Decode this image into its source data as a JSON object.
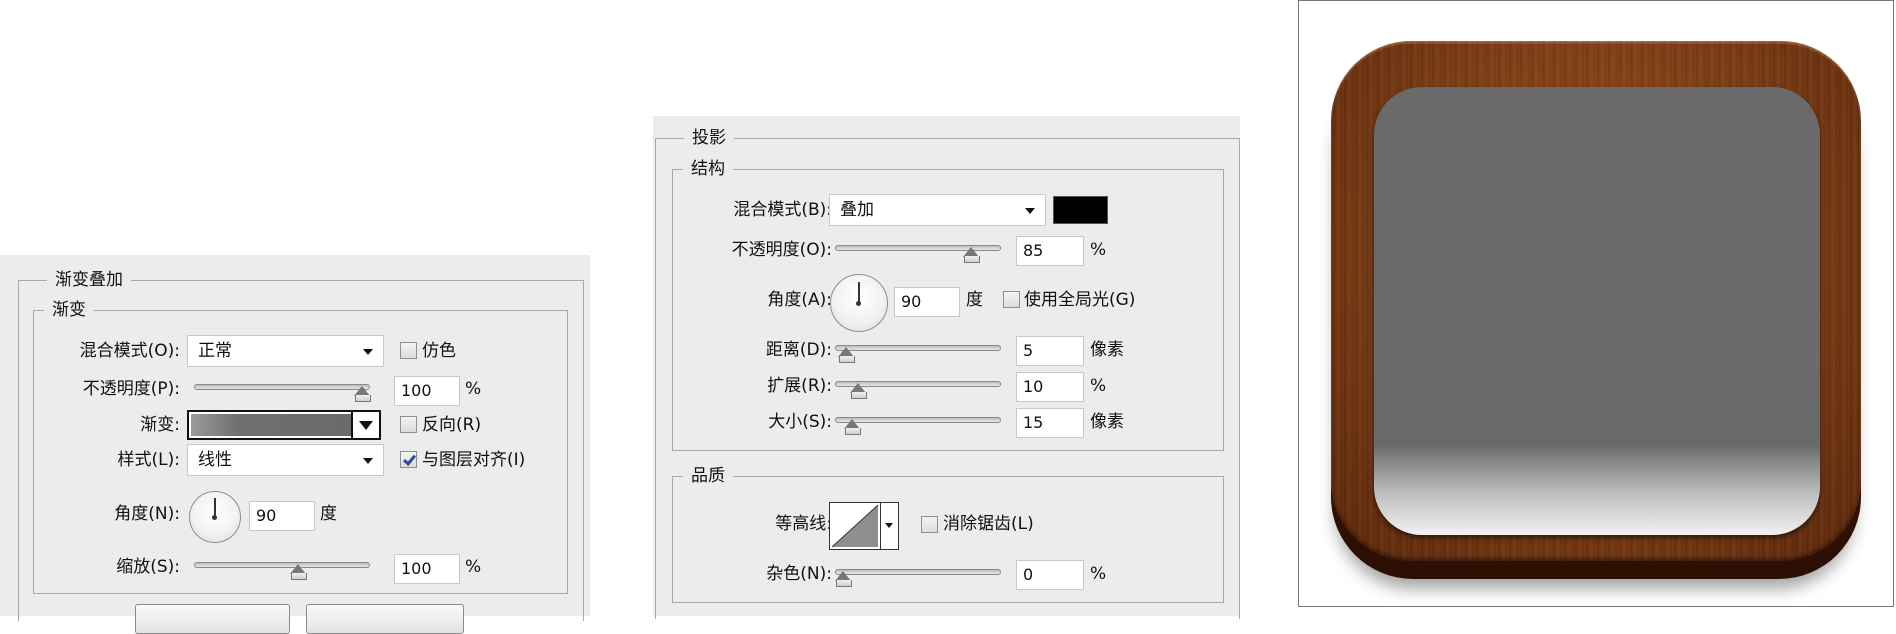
{
  "gradient_overlay": {
    "title": "渐变叠加",
    "group_title": "渐变",
    "blend_mode_label": "混合模式(O):",
    "blend_mode_value": "正常",
    "dither_label": "仿色",
    "dither_checked": false,
    "opacity_label": "不透明度(P):",
    "opacity_value": "100",
    "opacity_unit": "%",
    "opacity_level": 1.0,
    "gradient_label": "渐变:",
    "reverse_label": "反向(R)",
    "reverse_checked": false,
    "style_label": "样式(L):",
    "style_value": "线性",
    "align_label": "与图层对齐(I)",
    "align_checked": true,
    "angle_label": "角度(N):",
    "angle_value": "90",
    "angle_unit": "度",
    "scale_label": "缩放(S):",
    "scale_value": "100",
    "scale_unit": "%",
    "scale_level": 0.6
  },
  "drop_shadow": {
    "title": "投影",
    "structure_title": "结构",
    "blend_mode_label": "混合模式(B):",
    "blend_mode_value": "叠加",
    "shadow_color": "#000000",
    "opacity_label": "不透明度(O):",
    "opacity_value": "85",
    "opacity_unit": "%",
    "opacity_level": 0.85,
    "angle_label": "角度(A):",
    "angle_value": "90",
    "angle_unit": "度",
    "global_light_label": "使用全局光(G)",
    "global_light_checked": false,
    "distance_label": "距离(D):",
    "distance_value": "5",
    "distance_unit": "像素",
    "distance_level": 0.02,
    "spread_label": "扩展(R):",
    "spread_value": "10",
    "spread_unit": "%",
    "spread_level": 0.1,
    "size_label": "大小(S):",
    "size_value": "15",
    "size_unit": "像素",
    "size_level": 0.06,
    "quality_title": "品质",
    "contour_label": "等高线:",
    "antialias_label": "消除锯齿(L)",
    "antialias_checked": false,
    "noise_label": "杂色(N):",
    "noise_value": "0",
    "noise_unit": "%",
    "noise_level": 0.0
  },
  "preview": {
    "frame_color": "#7a3a12",
    "face_top_color": "#6a6a6a",
    "face_bottom_color": "#f2f2f2"
  }
}
